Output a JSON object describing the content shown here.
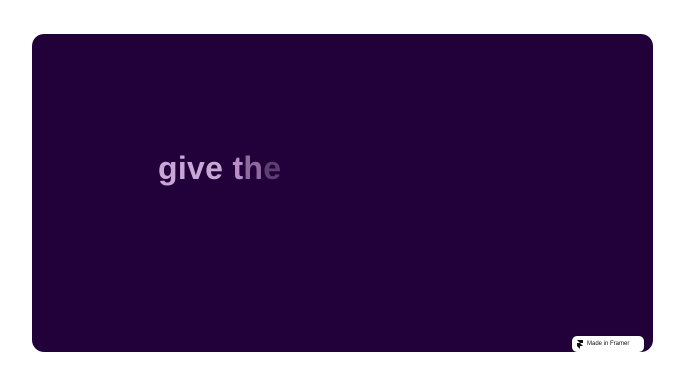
{
  "colors": {
    "stage_background": "#22003a",
    "page_background": "#ffffff",
    "text_primary": "#c8a6d6",
    "text_fade_1": "#b98ec7",
    "text_fade_2": "#8f6a9e",
    "text_fade_3": "#5e3d70"
  },
  "hero": {
    "word_1": "give",
    "letter_t": "t",
    "letter_h": "h",
    "letter_e": "e"
  },
  "badge": {
    "label": "Made in Framer",
    "icon": "framer-logo-icon"
  }
}
